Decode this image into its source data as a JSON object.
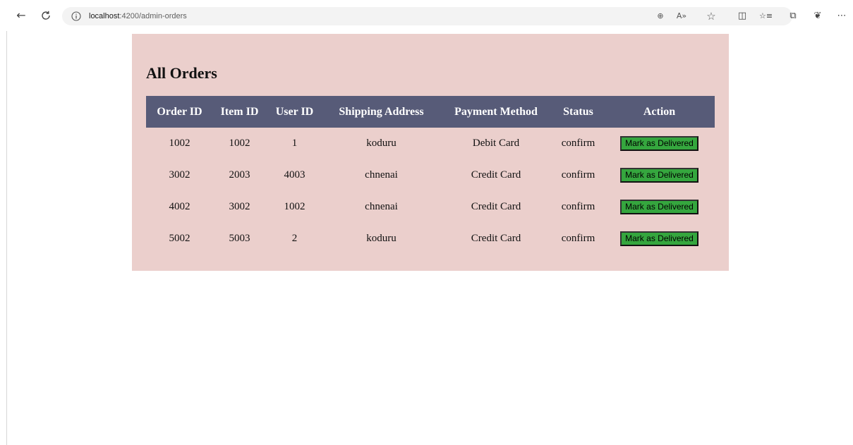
{
  "browser": {
    "url_host": "localhost",
    "url_rest": ":4200/admin-orders",
    "icons": [
      "back-arrow-icon",
      "refresh-icon",
      "info-icon",
      "zoom-icon",
      "read-aloud-icon",
      "favorite-star-icon",
      "split-screen-icon",
      "favorites-icon",
      "collections-icon",
      "extensions-icon",
      "more-icon"
    ],
    "glyphs": {
      "back": "←",
      "refresh": "↻",
      "zoom": "⊕",
      "read_aloud": "A»",
      "star": "☆",
      "split": "◫",
      "favorites": "☆≡",
      "collections": "⧉",
      "extensions": "❦",
      "more": "⋯"
    }
  },
  "page": {
    "title": "All Orders"
  },
  "orders_table": {
    "headers": [
      "Order ID",
      "Item ID",
      "User ID",
      "Shipping Address",
      "Payment Method",
      "Status",
      "Action"
    ],
    "rows": [
      {
        "order_id": "1002",
        "item_id": "1002",
        "user_id": "1",
        "address": "koduru",
        "payment": "Debit Card",
        "status": "confirm",
        "action": "Mark as Delivered"
      },
      {
        "order_id": "3002",
        "item_id": "2003",
        "user_id": "4003",
        "address": "chnenai",
        "payment": "Credit Card",
        "status": "confirm",
        "action": "Mark as Delivered"
      },
      {
        "order_id": "4002",
        "item_id": "3002",
        "user_id": "1002",
        "address": "chnenai",
        "payment": "Credit Card",
        "status": "confirm",
        "action": "Mark as Delivered"
      },
      {
        "order_id": "5002",
        "item_id": "5003",
        "user_id": "2",
        "address": "koduru",
        "payment": "Credit Card",
        "status": "confirm",
        "action": "Mark as Delivered"
      }
    ]
  },
  "colors": {
    "panel_bg": "#ebcfcc",
    "header_bg": "#575b78",
    "button_bg": "#35a63e"
  }
}
